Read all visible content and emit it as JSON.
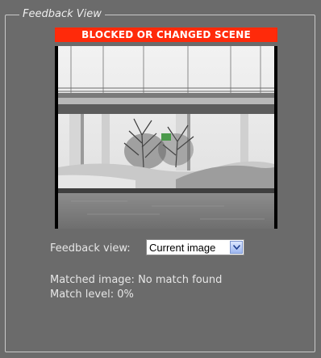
{
  "panel": {
    "legend": "Feedback View",
    "alert_text": "BLOCKED OR CHANGED SCENE",
    "alert_color": "#ff2a0a"
  },
  "camera": {
    "icon": "camera-feed-image"
  },
  "feedback": {
    "label": "Feedback view:",
    "selected": "Current image"
  },
  "status": {
    "matched_label": "Matched image:",
    "matched_value": "No match found",
    "level_label": "Match level:",
    "level_value": "0%"
  }
}
